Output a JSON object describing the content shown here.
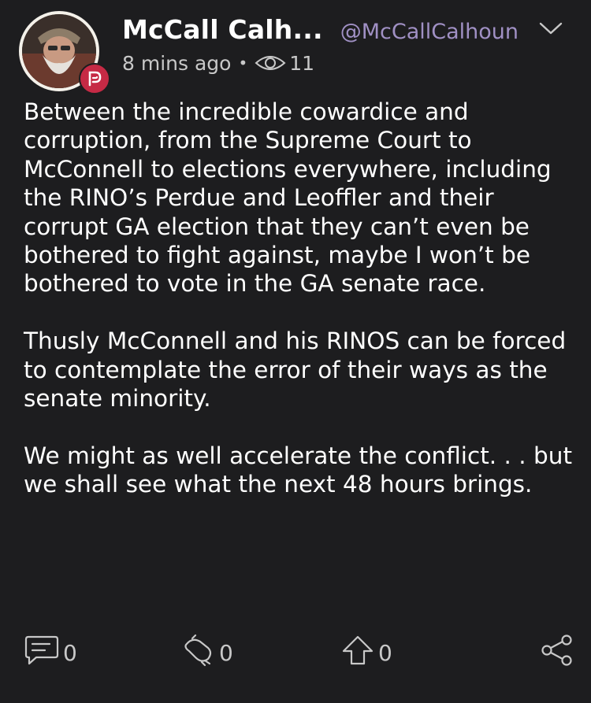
{
  "user": {
    "display_name": "McCall Calh...",
    "handle": "@McCallCalhoun"
  },
  "meta": {
    "time": "8 mins ago",
    "separator": "•",
    "views": "11"
  },
  "post": {
    "paragraphs": [
      "Between the incredible cowardice and corruption, from the Supreme Court to McConnell to elections everywhere, including the RINO’s Perdue and Leoffler and their corrupt GA election that they can’t even be bothered to fight against, maybe I won’t be bothered to vote in the GA senate race.",
      "Thusly McConnell and his RINOS can be forced to contemplate the error of their ways as the senate minority.",
      "We might as well accelerate the conflict. . . but we shall see what the next 48 hours brings."
    ]
  },
  "actions": {
    "comments": "0",
    "echoes": "0",
    "upvotes": "0"
  },
  "colors": {
    "background": "#1d1d1f",
    "handle": "#a090c4",
    "badge": "#c62a45",
    "muted": "#c8c8c8"
  },
  "icons": {
    "badge": "parler-logo-icon",
    "more": "chevron-down-icon",
    "views": "eye-icon",
    "comment": "comment-icon",
    "echo": "echo-icon",
    "upvote": "upvote-arrow-icon",
    "share": "share-icon"
  }
}
